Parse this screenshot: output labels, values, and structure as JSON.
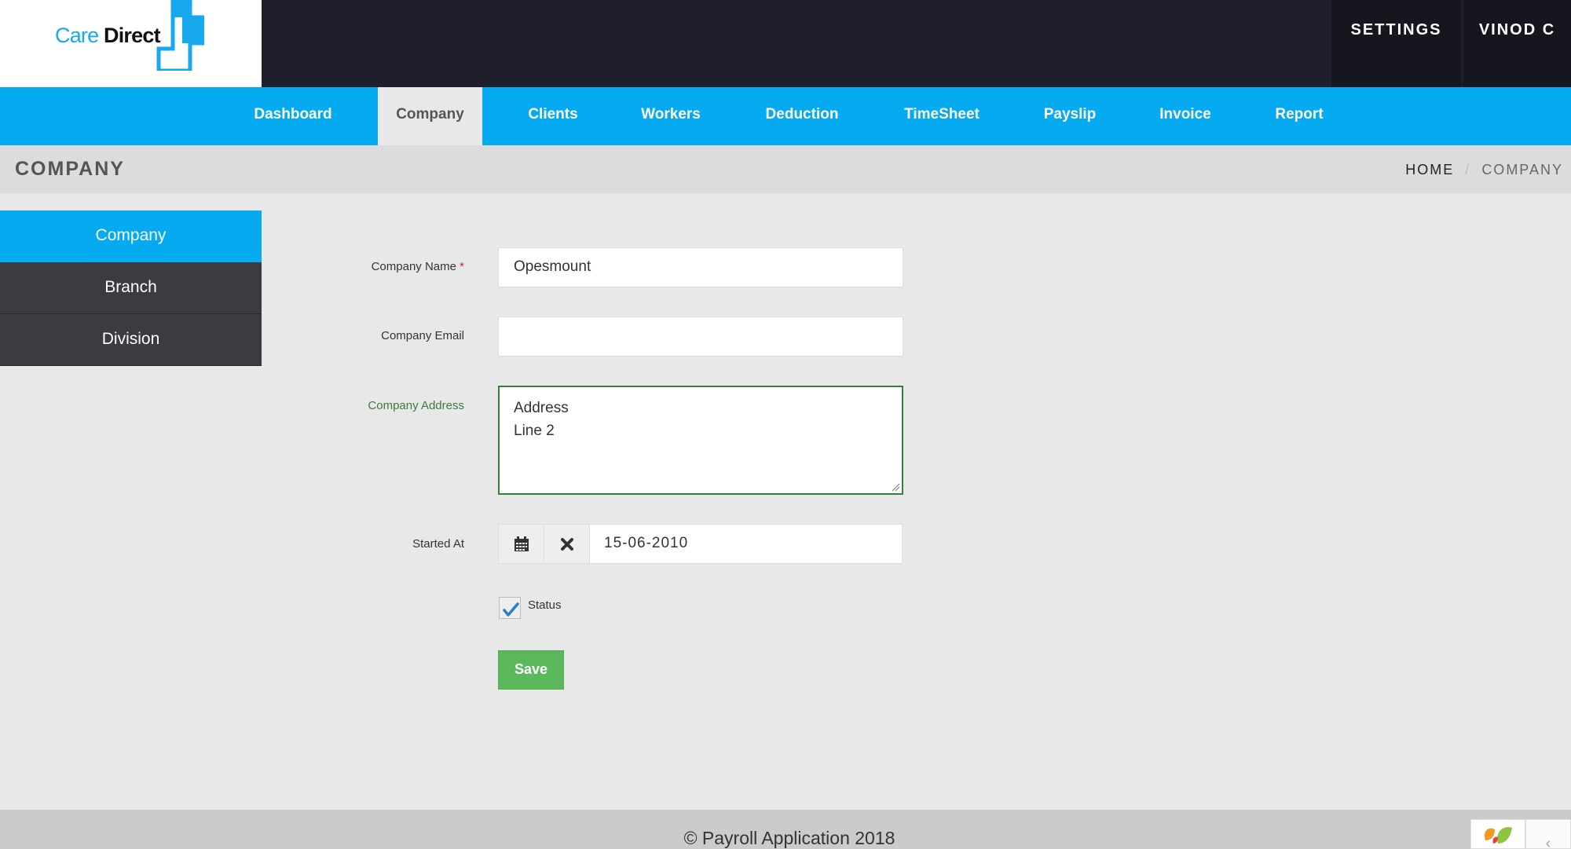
{
  "logo": {
    "care": "Care",
    "direct": "Direct"
  },
  "topbar": {
    "settings": "SETTINGS",
    "user": "VINOD C"
  },
  "nav": {
    "items": [
      {
        "label": "Dashboard",
        "active": false
      },
      {
        "label": "Company",
        "active": true
      },
      {
        "label": "Clients",
        "active": false
      },
      {
        "label": "Workers",
        "active": false
      },
      {
        "label": "Deduction",
        "active": false
      },
      {
        "label": "TimeSheet",
        "active": false
      },
      {
        "label": "Payslip",
        "active": false
      },
      {
        "label": "Invoice",
        "active": false
      },
      {
        "label": "Report",
        "active": false
      }
    ]
  },
  "page_header": {
    "title": "COMPANY",
    "breadcrumb": {
      "home": "HOME",
      "separator": "/",
      "current": "COMPANY"
    }
  },
  "sidebar": {
    "items": [
      {
        "label": "Company",
        "active": true
      },
      {
        "label": "Branch",
        "active": false
      },
      {
        "label": "Division",
        "active": false
      }
    ]
  },
  "form": {
    "company_name": {
      "label": "Company Name",
      "required_mark": "*",
      "value": "Opesmount"
    },
    "company_email": {
      "label": "Company Email",
      "value": ""
    },
    "company_address": {
      "label": "Company Address",
      "line1": "Address",
      "line2": "Line 2"
    },
    "started_at": {
      "label": "Started At",
      "value": "15-06-2010"
    },
    "status": {
      "label": "Status",
      "checked": true
    },
    "save_label": "Save"
  },
  "footer": {
    "text": "© Payroll Application 2018"
  },
  "colors": {
    "primary_blue": "#06aaf0",
    "topbar_dark": "#1f1f2b",
    "sidebar_dark": "#3b3b40",
    "save_green": "#5cb85c",
    "focus_green": "#3a7d3a"
  }
}
